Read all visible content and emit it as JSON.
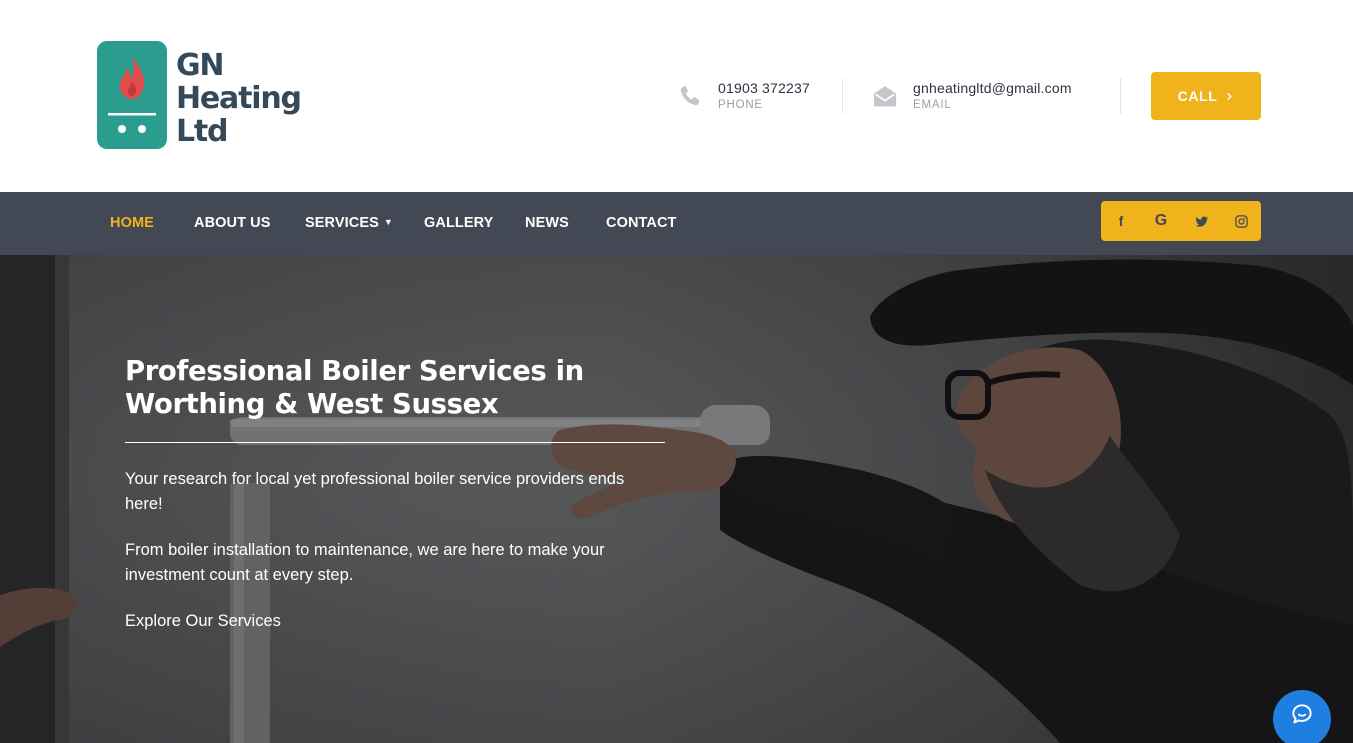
{
  "brand": {
    "name_line1": "GN",
    "name_line2": "Heating",
    "name_line3": "Ltd",
    "logo_color": "#2a9d8f",
    "flame_color": "#e44b4b",
    "text_color": "#34495a"
  },
  "contact": {
    "phone": {
      "value": "01903 372237",
      "label": "PHONE",
      "icon": "phone-icon"
    },
    "email": {
      "value": "gnheatingltd@gmail.com",
      "label": "EMAIL",
      "icon": "envelope-icon"
    }
  },
  "call_button": {
    "label": "CALL",
    "icon": "chevron-right-icon"
  },
  "nav": {
    "items": [
      {
        "label": "HOME",
        "active": true
      },
      {
        "label": "ABOUT US",
        "active": false
      },
      {
        "label": "SERVICES",
        "active": false,
        "has_dropdown": true
      },
      {
        "label": "GALLERY",
        "active": false
      },
      {
        "label": "NEWS",
        "active": false
      },
      {
        "label": "CONTACT",
        "active": false
      }
    ]
  },
  "social": {
    "facebook": "f",
    "google": "G",
    "twitter": "twitter-bird-icon",
    "instagram": "instagram-icon"
  },
  "hero": {
    "title_line1": "Professional Boiler Services in",
    "title_line2": "Worthing & West Sussex",
    "paragraph1": "Your research for local yet professional boiler service providers ends here!",
    "paragraph2": "From boiler installation to maintenance, we are here to make your investment count at every step.",
    "link": "Explore Our Services"
  },
  "chat": {
    "icon": "chat-bubble-icon"
  },
  "colors": {
    "accent": "#f1b31c",
    "nav_bg": "#434855",
    "chat_blue": "#1e7fe0"
  }
}
